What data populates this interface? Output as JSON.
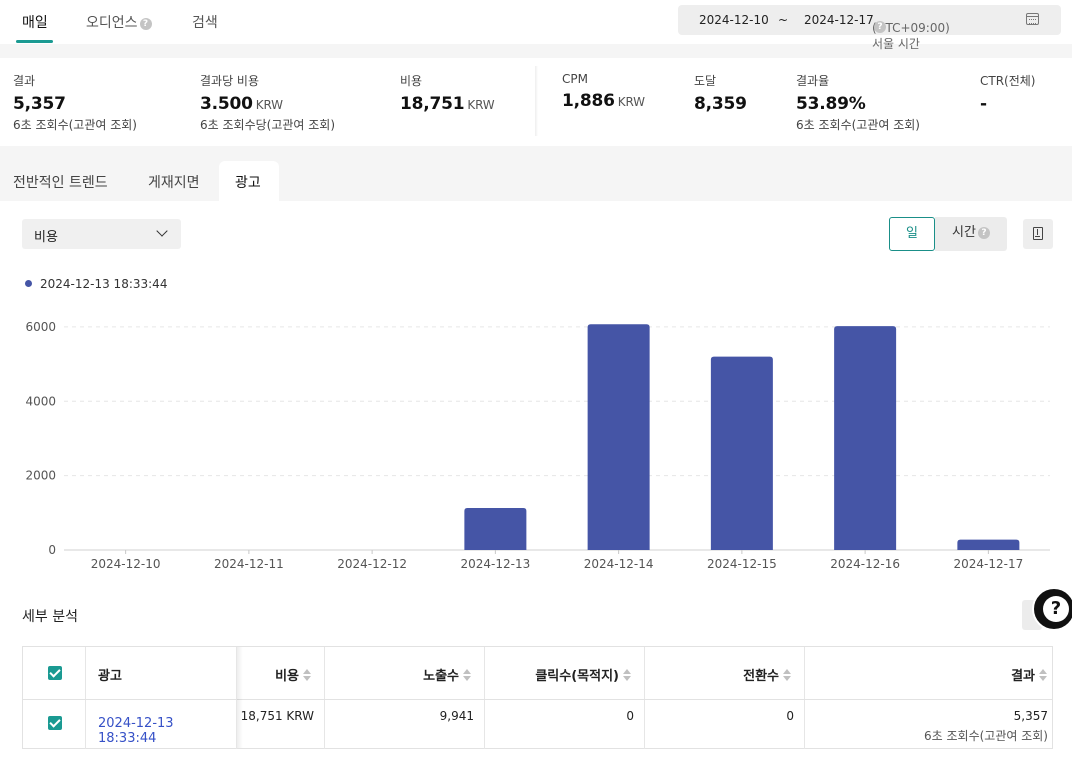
{
  "topnav": {
    "tabs": [
      {
        "label": "매일"
      },
      {
        "label": "오디언스"
      },
      {
        "label": "검색"
      }
    ],
    "date_range": {
      "start": "2024-12-10",
      "separator": "~",
      "end": "2024-12-17",
      "timezone": "(UTC+09:00) 서울 시간"
    }
  },
  "metrics": [
    {
      "label": "결과",
      "value": "5,357",
      "unit": "",
      "sub": "6초 조회수(고관여 조회)"
    },
    {
      "label": "결과당 비용",
      "value": "3.500",
      "unit": "KRW",
      "sub": "6초 조회수당(고관여 조회)"
    },
    {
      "label": "비용",
      "value": "18,751",
      "unit": "KRW",
      "sub": ""
    },
    {
      "label": "CPM",
      "value": "1,886",
      "unit": "KRW",
      "sub": ""
    },
    {
      "label": "도달",
      "value": "8,359",
      "unit": "",
      "sub": ""
    },
    {
      "label": "결과율",
      "value": "53.89%",
      "unit": "",
      "sub": "6초 조회수(고관여 조회)"
    },
    {
      "label": "CTR(전체)",
      "value": "-",
      "unit": "",
      "sub": ""
    }
  ],
  "content_tabs": [
    {
      "label": "전반적인 트렌드"
    },
    {
      "label": "게재지면"
    },
    {
      "label": "광고"
    }
  ],
  "controls": {
    "metric_select": "비용",
    "granularity_day": "일",
    "granularity_hour": "시간"
  },
  "chart_data": {
    "type": "bar",
    "categories": [
      "2024-12-10",
      "2024-12-11",
      "2024-12-12",
      "2024-12-13",
      "2024-12-14",
      "2024-12-15",
      "2024-12-16",
      "2024-12-17"
    ],
    "series": [
      {
        "name": "2024-12-13 18:33:44",
        "color": "#4555a6",
        "values": [
          0,
          0,
          0,
          1130,
          6070,
          5200,
          6020,
          280
        ]
      }
    ],
    "yticks": [
      0,
      2000,
      4000,
      6000
    ],
    "ylim": [
      0,
      6400
    ],
    "grid": true,
    "legend": "top-left"
  },
  "breakdown": {
    "title": "세부 분석",
    "columns": [
      {
        "label": "광고"
      },
      {
        "label": "비용"
      },
      {
        "label": "노출수"
      },
      {
        "label": "클릭수(목적지)"
      },
      {
        "label": "전환수"
      },
      {
        "label": "결과"
      }
    ],
    "rows": [
      {
        "ad": "2024-12-13 18:33:44",
        "cost": "18,751 KRW",
        "impressions": "9,941",
        "clicks": "0",
        "conversions": "0",
        "result": "5,357",
        "result_sub": "6초 조회수(고관여 조회)"
      }
    ]
  },
  "help_label": "?"
}
